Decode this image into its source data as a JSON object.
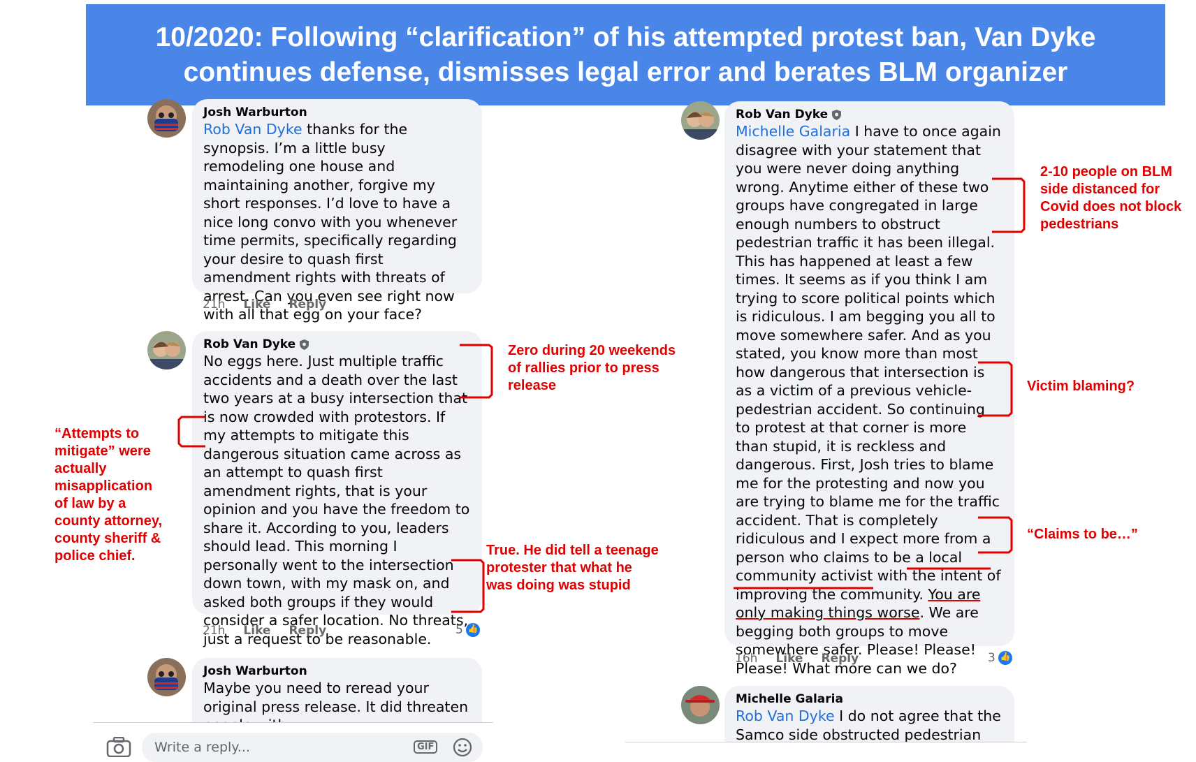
{
  "banner": {
    "line1": "10/2020: Following “clarification” of his attempted protest ban, Van Dyke",
    "line2": "continues defense, dismisses legal error and berates BLM organizer"
  },
  "left_thread": {
    "comment1": {
      "author": "Josh Warburton",
      "mention": "Rob Van Dyke",
      "text": " thanks for the synopsis. I’m a little busy remodeling one house and maintaining another, forgive my short responses. I’d love to have a nice long convo with you whenever time permits, specifically regarding your desire to quash first amendment rights with threats of arrest. Can you even see right now with all that egg on your face?",
      "time": "21h",
      "like": "Like",
      "reply": "Reply"
    },
    "comment2": {
      "author": "Rob Van Dyke",
      "text": "No eggs here. Just multiple traffic accidents and a death over the last two years at a busy intersection that is now crowded with protestors. If my attempts to mitigate this dangerous situation came across as an attempt to quash first amendment rights, that is your opinion and you have the freedom to share it. According to you, leaders should lead. This morning I personally went to the intersection down town, with my mask on, and asked both groups if they would consider a safer location. No threats, just a request to be reasonable.",
      "time": "21h",
      "like": "Like",
      "reply": "Reply",
      "reaction_count": "5"
    },
    "comment3": {
      "author": "Josh Warburton",
      "text": "Maybe you need to reread your original press release. It did threaten people with"
    },
    "reply_placeholder": "Write a reply...",
    "gif_label": "GIF"
  },
  "right_thread": {
    "comment1": {
      "author": "Rob Van Dyke",
      "mention": "Michelle Galaria",
      "text_a": " I have to once again disagree with your statement that you were never doing anything wrong. Anytime either of these two groups have congregated in large enough numbers to obstruct pedestrian traffic it has been illegal. This has happened at least a few times. It seems as if you think I am trying to score political points which is ridiculous. I am begging you all to move somewhere safer. And as you stated, you know more than most how dangerous that intersection is as a victim of a previous vehicle-pedestrian accident. So continuing to protest at that corner is more than stupid, it is reckless and dangerous.  First, Josh tries to blame me for the protesting and now you are trying to blame me for the traffic accident.  That is completely ridiculous and I expect more from a person who claims to be a local community activist with the intent of improving the community. ",
      "underlined": "You are only making things worse",
      "text_b": ". We are begging both groups to move somewhere safer. Please! Please! Please!   What more can we do?",
      "time": "16h",
      "like": "Like",
      "reply": "Reply",
      "reaction_count": "3"
    },
    "comment2": {
      "author": "Michelle Galaria",
      "mention": "Rob Van Dyke",
      "text": " I do not agree that the Samco side obstructed pedestrian"
    }
  },
  "annotations": {
    "zero_rallies": "Zero during 20 weekends of rallies prior to press release",
    "attempts_mitigate": "“Attempts to mitigate” were actually misapplication of law by a county attorney, county sheriff & police chief.",
    "true_stupid": "True.  He did tell a teenage protester that what he was doing was stupid",
    "blm_distanced": "2-10 people on BLM side distanced for Covid does not block pedestrians",
    "victim_blaming": "Victim blaming?",
    "claims_to_be": "“Claims to be…”"
  },
  "colors": {
    "banner": "#4a86e8",
    "annotation": "#e00000",
    "mention": "#216fdb",
    "bubble": "#f0f2f5"
  }
}
